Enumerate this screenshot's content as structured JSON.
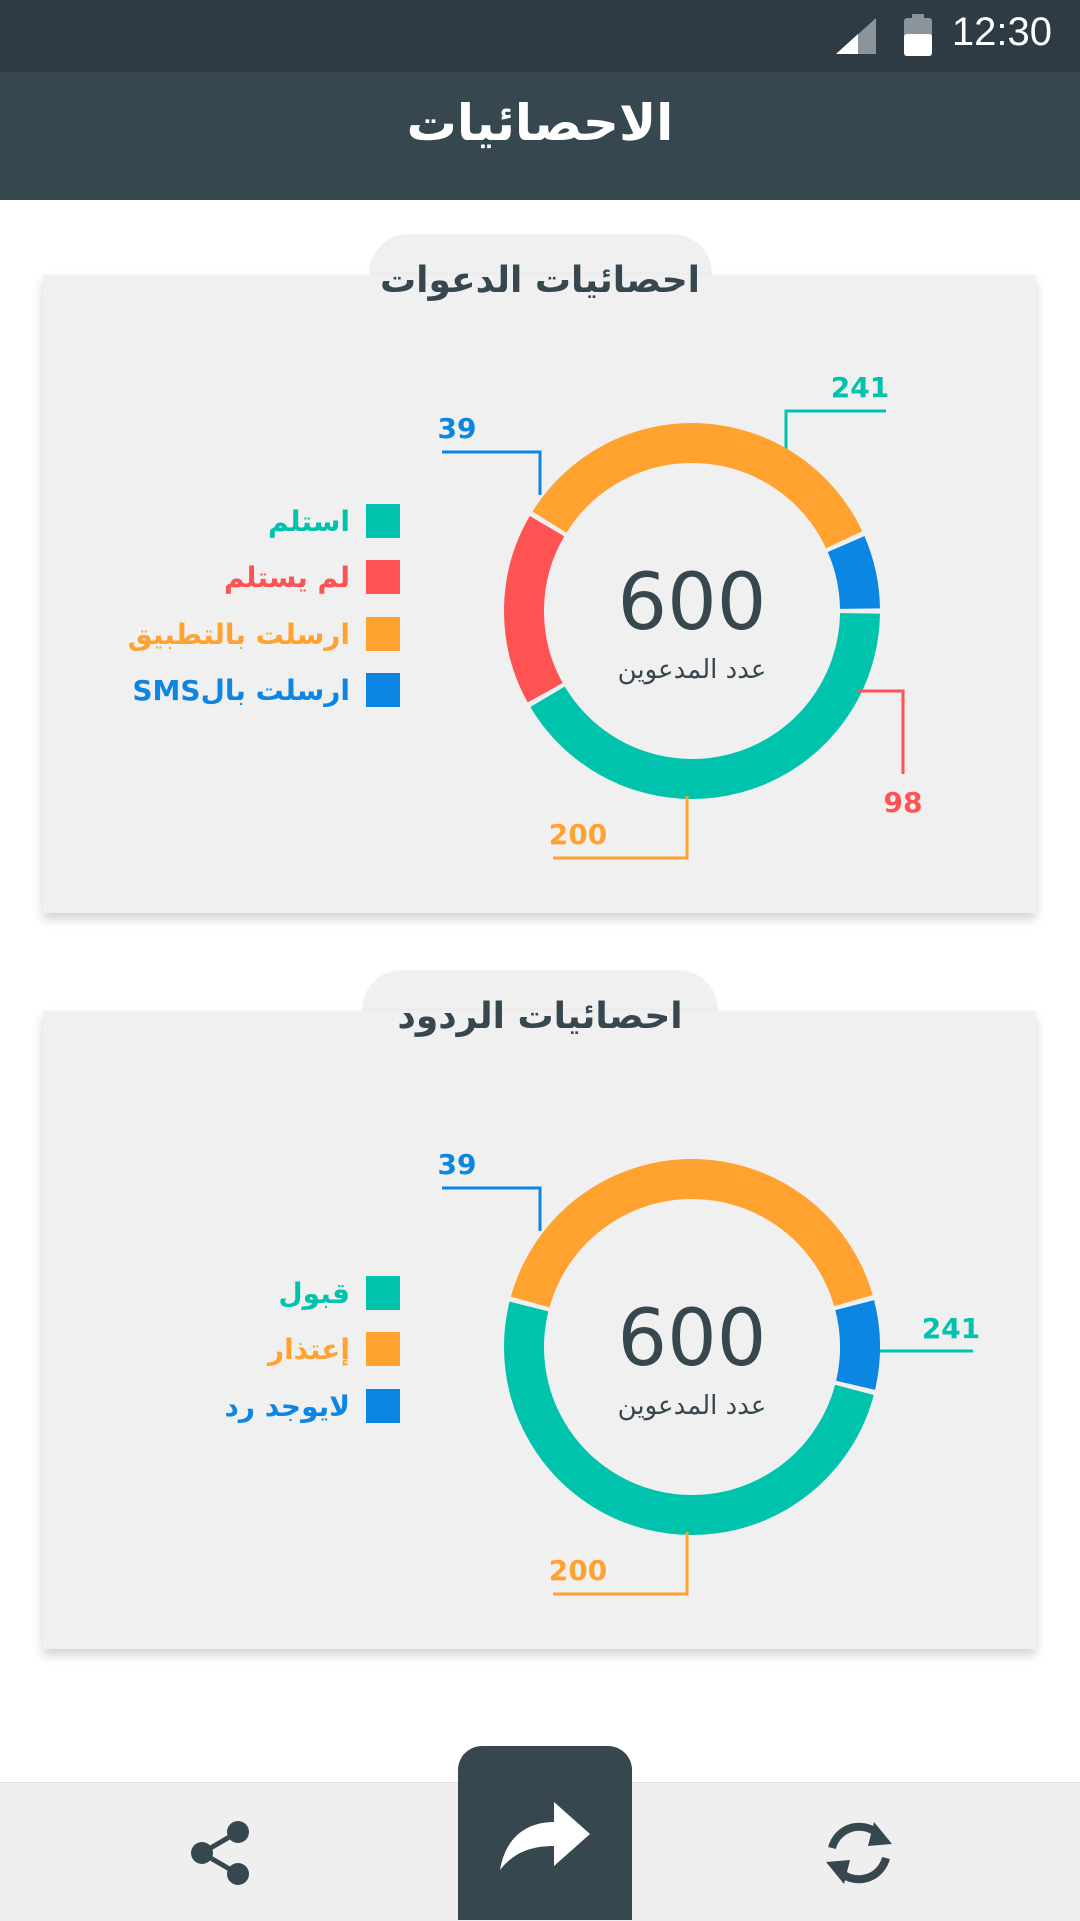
{
  "status_bar": {
    "time": "12:30",
    "icons": [
      "signal-icon",
      "battery-icon"
    ]
  },
  "app_bar": {
    "title": "الاحصائيات"
  },
  "colors": {
    "teal": "#00c3ad",
    "red": "#ff5252",
    "orange": "#ffa22f",
    "blue": "#0b86e3",
    "dark": "#37474f"
  },
  "chart_data": [
    {
      "type": "pie",
      "title": "احصائيات الدعوات",
      "center_value": "600",
      "center_label": "عدد المدعوين",
      "categories": [
        "استلم",
        "لم يستلم",
        "ارسلت بالتطبيق",
        "ارسلت بالSMS"
      ],
      "values": [
        241,
        98,
        200,
        39
      ],
      "colors": [
        "#00c3ad",
        "#ff5252",
        "#ffa22f",
        "#0b86e3"
      ]
    },
    {
      "type": "pie",
      "title": "احصائيات الردود",
      "center_value": "600",
      "center_label": "عدد المدعوين",
      "categories": [
        "قبول",
        "إعتذار",
        "لايوجد رد"
      ],
      "values": [
        241,
        200,
        39
      ],
      "colors": [
        "#00c3ad",
        "#ffa22f",
        "#0b86e3"
      ]
    }
  ],
  "bottom_nav": {
    "items": [
      "share-icon",
      "forward-icon",
      "refresh-icon"
    ]
  }
}
